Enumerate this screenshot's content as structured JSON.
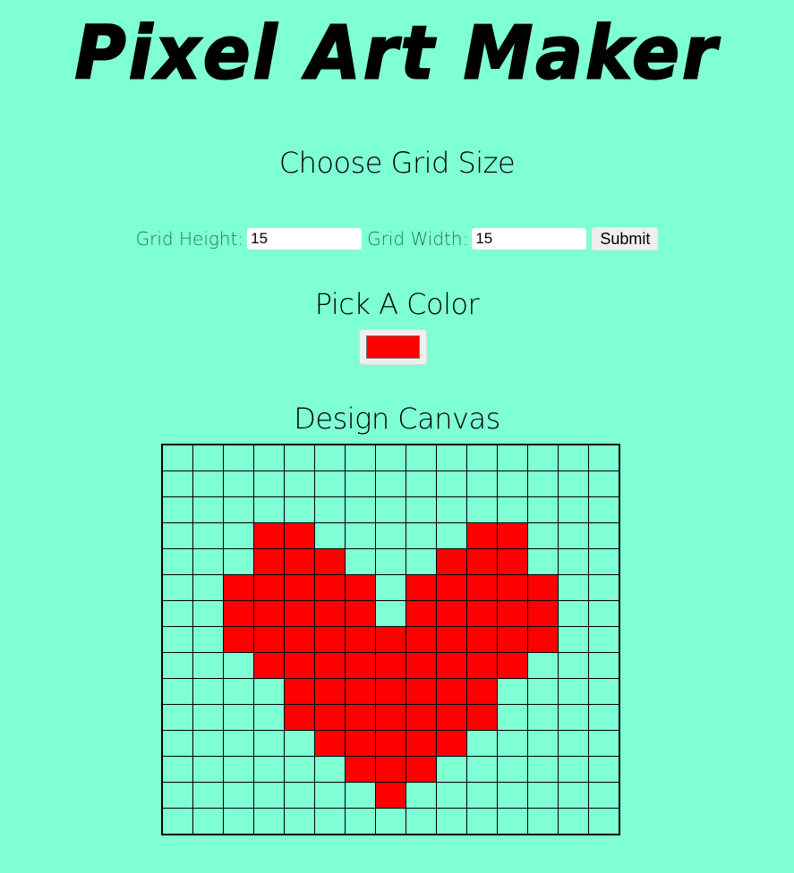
{
  "header": {
    "title": "Pixel Art Maker"
  },
  "grid_size": {
    "heading": "Choose Grid Size",
    "height_label": "Grid Height:",
    "height_value": "15",
    "width_label": "Grid Width:",
    "width_value": "15",
    "submit_label": "Submit"
  },
  "color": {
    "heading": "Pick A Color",
    "selected": "#ff0000"
  },
  "canvas": {
    "heading": "Design Canvas",
    "rows": 15,
    "cols": 15,
    "background": "#7fffd4",
    "paint_color": "#ff0000",
    "painted_cells": [
      [
        3,
        3
      ],
      [
        3,
        4
      ],
      [
        3,
        10
      ],
      [
        3,
        11
      ],
      [
        4,
        3
      ],
      [
        4,
        4
      ],
      [
        4,
        5
      ],
      [
        4,
        9
      ],
      [
        4,
        10
      ],
      [
        4,
        11
      ],
      [
        5,
        2
      ],
      [
        5,
        3
      ],
      [
        5,
        4
      ],
      [
        5,
        5
      ],
      [
        5,
        6
      ],
      [
        5,
        8
      ],
      [
        5,
        9
      ],
      [
        5,
        10
      ],
      [
        5,
        11
      ],
      [
        5,
        12
      ],
      [
        6,
        2
      ],
      [
        6,
        3
      ],
      [
        6,
        4
      ],
      [
        6,
        5
      ],
      [
        6,
        6
      ],
      [
        6,
        8
      ],
      [
        6,
        9
      ],
      [
        6,
        10
      ],
      [
        6,
        11
      ],
      [
        6,
        12
      ],
      [
        7,
        2
      ],
      [
        7,
        3
      ],
      [
        7,
        4
      ],
      [
        7,
        5
      ],
      [
        7,
        6
      ],
      [
        7,
        7
      ],
      [
        7,
        8
      ],
      [
        7,
        9
      ],
      [
        7,
        10
      ],
      [
        7,
        11
      ],
      [
        7,
        12
      ],
      [
        8,
        3
      ],
      [
        8,
        4
      ],
      [
        8,
        5
      ],
      [
        8,
        6
      ],
      [
        8,
        7
      ],
      [
        8,
        8
      ],
      [
        8,
        9
      ],
      [
        8,
        10
      ],
      [
        8,
        11
      ],
      [
        9,
        4
      ],
      [
        9,
        5
      ],
      [
        9,
        6
      ],
      [
        9,
        7
      ],
      [
        9,
        8
      ],
      [
        9,
        9
      ],
      [
        9,
        10
      ],
      [
        10,
        4
      ],
      [
        10,
        5
      ],
      [
        10,
        6
      ],
      [
        10,
        7
      ],
      [
        10,
        8
      ],
      [
        10,
        9
      ],
      [
        10,
        10
      ],
      [
        11,
        5
      ],
      [
        11,
        6
      ],
      [
        11,
        7
      ],
      [
        11,
        8
      ],
      [
        11,
        9
      ],
      [
        12,
        6
      ],
      [
        12,
        7
      ],
      [
        12,
        8
      ],
      [
        13,
        7
      ]
    ]
  }
}
